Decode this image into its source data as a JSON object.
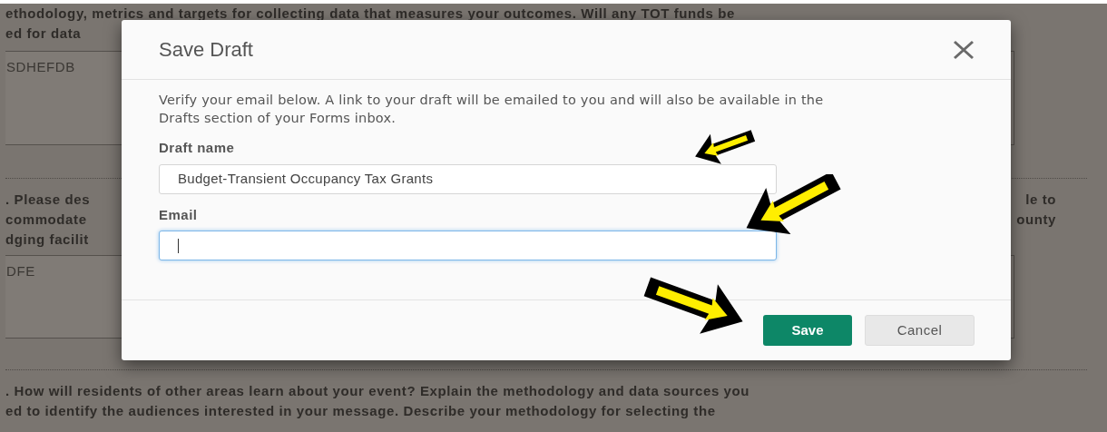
{
  "background": {
    "lines": [
      {
        "left": "ethodology, metrics and targets for collecting data that measures your outcomes. Will any TOT funds be"
      },
      {
        "left": "ed for data"
      }
    ],
    "answer_1": "SDHEFDB",
    "question_2": [
      {
        "left": ". Please des",
        "right": "le to"
      },
      {
        "left": "commodate",
        "right": "ounty"
      },
      {
        "left": "dging facilit"
      }
    ],
    "answer_2": "DFE",
    "question_3": [
      {
        "left": ".  How will residents of other areas learn about your event? Explain the methodology and data sources you"
      },
      {
        "left": "ed to identify the audiences interested in your message.  Describe your methodology for selecting the"
      }
    ]
  },
  "dialog": {
    "title": "Save Draft",
    "message": "Verify your email below. A link to your draft will be emailed to you and will also be available in the Drafts section of your Forms inbox.",
    "fields": [
      {
        "label": "Draft name",
        "value": "Budget-Transient Occupancy Tax Grants",
        "focused": false
      },
      {
        "label": "Email",
        "focused": true
      }
    ],
    "buttons": [
      {
        "label": "Save",
        "kind": "primary"
      },
      {
        "label": "Cancel",
        "kind": "secondary"
      }
    ]
  }
}
